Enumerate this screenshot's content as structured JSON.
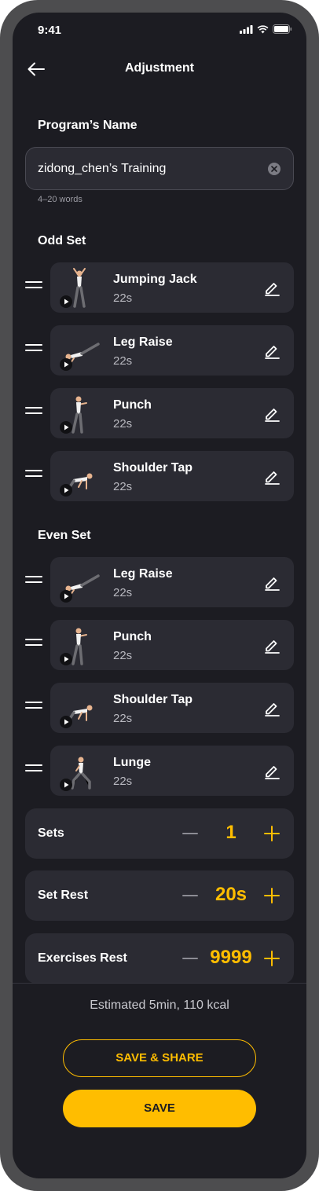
{
  "status_bar": {
    "time": "9:41"
  },
  "header": {
    "title": "Adjustment"
  },
  "program": {
    "label": "Program’s Name",
    "value": "zidong_chen’s Training",
    "hint": "4–20 words"
  },
  "odd_set": {
    "label": "Odd Set",
    "items": [
      {
        "name": "Jumping Jack",
        "duration": "22s"
      },
      {
        "name": "Leg Raise",
        "duration": "22s"
      },
      {
        "name": "Punch",
        "duration": "22s"
      },
      {
        "name": "Shoulder Tap",
        "duration": "22s"
      }
    ]
  },
  "even_set": {
    "label": "Even Set",
    "items": [
      {
        "name": "Leg Raise",
        "duration": "22s"
      },
      {
        "name": "Punch",
        "duration": "22s"
      },
      {
        "name": "Shoulder Tap",
        "duration": "22s"
      },
      {
        "name": "Lunge",
        "duration": "22s"
      }
    ]
  },
  "settings": {
    "sets": {
      "label": "Sets",
      "value": "1"
    },
    "set_rest": {
      "label": "Set Rest",
      "value": "20s"
    },
    "exercises_rest": {
      "label": "Exercises Rest",
      "value": "9999"
    }
  },
  "footer": {
    "estimate": "Estimated 5min, 110 kcal",
    "save_share_label": "SAVE & SHARE",
    "save_label": "SAVE"
  },
  "colors": {
    "background": "#1c1c22",
    "card": "#2b2b33",
    "accent": "#ffbd00"
  }
}
